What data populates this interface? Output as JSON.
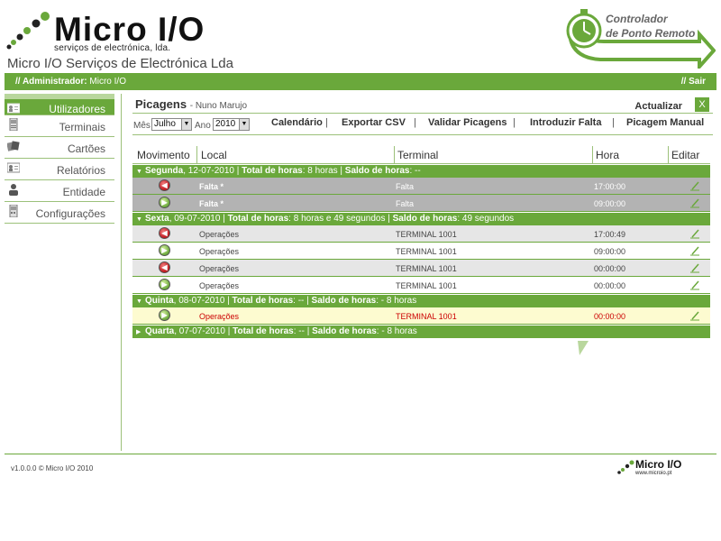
{
  "header": {
    "logo_name": "Micro I/O",
    "logo_tagline": "serviços de electrónica, lda.",
    "company_name": "Micro I/O Serviços de Electrónica Lda",
    "product_line1": "Controlador",
    "product_line2": "de Ponto Remoto"
  },
  "topbar": {
    "admin_label": "// Administrador:",
    "admin_name": "Micro I/O",
    "logout": "// Sair"
  },
  "sidebar": {
    "items": [
      {
        "label": "Utilizadores",
        "icon": "user-card-icon",
        "active": true
      },
      {
        "label": "Terminais",
        "icon": "terminal-device-icon"
      },
      {
        "label": "Cartões",
        "icon": "cards-icon"
      },
      {
        "label": "Relatórios",
        "icon": "report-card-icon"
      },
      {
        "label": "Entidade",
        "icon": "entity-person-icon"
      },
      {
        "label": "Configurações",
        "icon": "settings-device-icon"
      }
    ]
  },
  "page": {
    "title": "Picagens",
    "subtitle": "- Nuno Marujo",
    "refresh": "Actualizar",
    "close": "X"
  },
  "filters": {
    "month_label": "Mês",
    "month_value": "Julho",
    "year_label": "Ano",
    "year_value": "2010",
    "links": [
      "Calendário",
      "Exportar CSV",
      "Validar Picagens",
      "Introduzir Falta",
      "Picagem Manual"
    ],
    "separator": "|"
  },
  "table": {
    "columns": [
      "Movimento",
      "Local",
      "Terminal",
      "Hora",
      "Editar"
    ],
    "groups": [
      {
        "expanded": true,
        "day": "Segunda",
        "date": ", 12-07-2010 |",
        "total_label": "Total de horas",
        "total_value": ": 8 horas |",
        "saldo_label": "Saldo de horas",
        "saldo_value": ": --",
        "rows": [
          {
            "type": "out",
            "style": "falta",
            "local": "Falta *",
            "terminal": "Falta",
            "hora": "17:00:00"
          },
          {
            "type": "in",
            "style": "falta",
            "local": "Falta *",
            "terminal": "Falta",
            "hora": "09:00:00"
          }
        ]
      },
      {
        "expanded": true,
        "day": "Sexta",
        "date": ", 09-07-2010 |",
        "total_label": "Total de horas",
        "total_value": ": 8 horas e 49 segundos |",
        "saldo_label": "Saldo de horas",
        "saldo_value": ": 49 segundos",
        "rows": [
          {
            "type": "out",
            "style": "grey",
            "local": "Operações",
            "terminal": "TERMINAL 1001",
            "hora": "17:00:49"
          },
          {
            "type": "in",
            "style": "white",
            "local": "Operações",
            "terminal": "TERMINAL 1001",
            "hora": "09:00:00"
          },
          {
            "type": "out",
            "style": "grey",
            "local": "Operações",
            "terminal": "TERMINAL 1001",
            "hora": "00:00:00"
          },
          {
            "type": "in",
            "style": "white",
            "local": "Operações",
            "terminal": "TERMINAL 1001",
            "hora": "00:00:00"
          }
        ]
      },
      {
        "expanded": true,
        "day": "Quinta",
        "date": ", 08-07-2010 |",
        "total_label": "Total de horas",
        "total_value": ": -- |",
        "saldo_label": "Saldo de horas",
        "saldo_value": ": - 8 horas",
        "rows": [
          {
            "type": "in",
            "style": "hl",
            "local": "Operações",
            "terminal": "TERMINAL 1001",
            "hora": "00:00:00"
          }
        ]
      },
      {
        "expanded": false,
        "day": "Quarta",
        "date": ", 07-07-2010 |",
        "total_label": "Total de horas",
        "total_value": ": -- |",
        "saldo_label": "Saldo de horas",
        "saldo_value": ": - 8 horas",
        "rows": []
      }
    ]
  },
  "footer": {
    "version": "v1.0.0.0 © Micro I/O 2010",
    "logo_name": "Micro I/O",
    "logo_url": "www.microio.pt"
  },
  "colors": {
    "accent": "#6aa83b",
    "row_grey": "#e6e6e6",
    "falta_row": "#b3b3b3",
    "highlight_row": "#fdfbd0",
    "highlight_text": "#cc0000"
  }
}
